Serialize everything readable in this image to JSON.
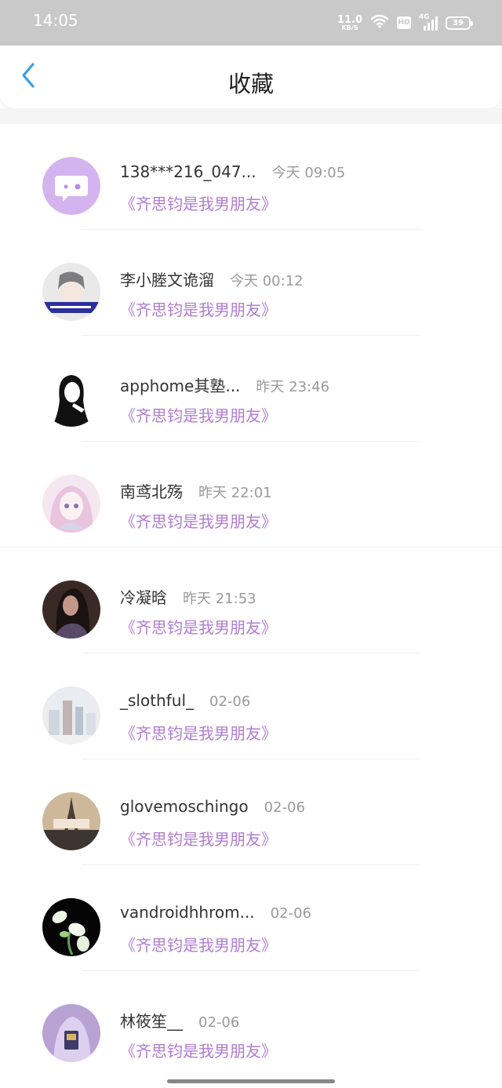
{
  "status_bar": {
    "time": "14:05",
    "net_speed_value": "11.0",
    "net_speed_unit": "KB/S",
    "hd_label": "HD",
    "network": "4G",
    "battery": "39"
  },
  "header": {
    "title": "收藏"
  },
  "colors": {
    "accent": "#3aa0e8",
    "subject": "#b07dd1",
    "status_bar": "#c9c9c9"
  },
  "favorites": [
    {
      "name": "138***216_047...",
      "time": "今天 09:05",
      "subject": "《齐思钧是我男朋友》",
      "avatar_icon": "chat-bubble-icon"
    },
    {
      "name": "李小塍文诡溜",
      "time": "今天 00:12",
      "subject": "《齐思钧是我男朋友》",
      "avatar_icon": "user-photo"
    },
    {
      "name": "apphome其塾...",
      "time": "昨天 23:46",
      "subject": "《齐思钧是我男朋友》",
      "avatar_icon": "user-sketch"
    },
    {
      "name": "南鸢北殇",
      "time": "昨天 22:01",
      "subject": "《齐思钧是我男朋友》",
      "avatar_icon": "anime-girl"
    },
    {
      "name": "冷凝晗",
      "time": "昨天 21:53",
      "subject": "《齐思钧是我男朋友》",
      "avatar_icon": "user-photo"
    },
    {
      "name": "_slothful_",
      "time": "02-06",
      "subject": "《齐思钧是我男朋友》",
      "avatar_icon": "city-photo"
    },
    {
      "name": "glovemoschingo",
      "time": "02-06",
      "subject": "《齐思钧是我男朋友》",
      "avatar_icon": "eiffel-photo"
    },
    {
      "name": "vandroidhhrom...",
      "time": "02-06",
      "subject": "《齐思钧是我男朋友》",
      "avatar_icon": "flower-photo"
    },
    {
      "name": "林筱笙__",
      "time": "02-06",
      "subject": "《齐思钧是我男朋友》",
      "avatar_icon": "user-photo"
    }
  ]
}
